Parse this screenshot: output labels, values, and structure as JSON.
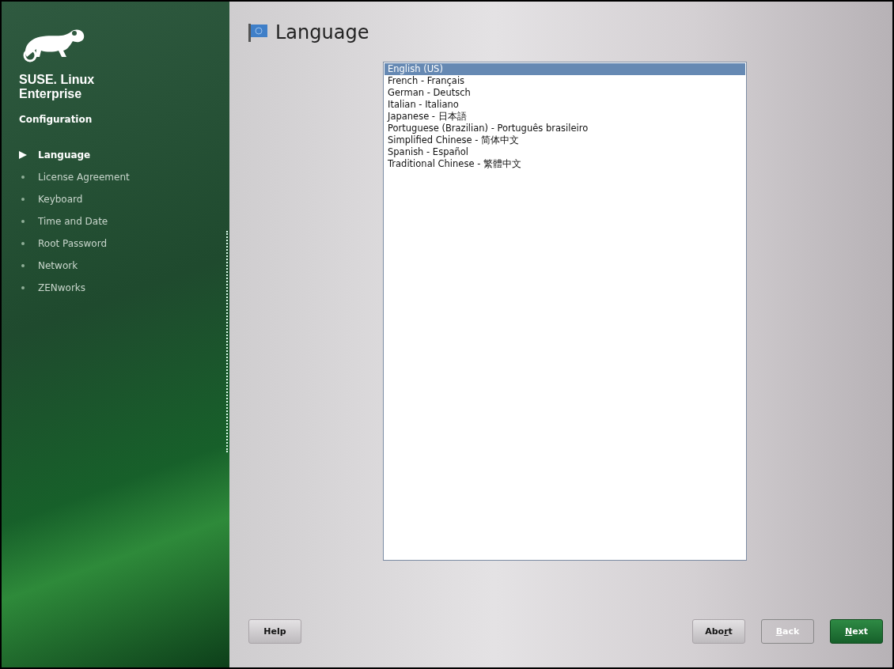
{
  "sidebar": {
    "brand": [
      "SUSE. Linux",
      "Enterprise"
    ],
    "section": "Configuration",
    "steps": [
      {
        "label": "Language",
        "current": true
      },
      {
        "label": "License Agreement",
        "current": false
      },
      {
        "label": "Keyboard",
        "current": false
      },
      {
        "label": "Time and Date",
        "current": false
      },
      {
        "label": "Root Password",
        "current": false
      },
      {
        "label": "Network",
        "current": false
      },
      {
        "label": "ZENworks",
        "current": false
      }
    ]
  },
  "page": {
    "title": "Language"
  },
  "languages": [
    {
      "label": "English (US)",
      "selected": true
    },
    {
      "label": "French - Français",
      "selected": false
    },
    {
      "label": "German - Deutsch",
      "selected": false
    },
    {
      "label": "Italian - Italiano",
      "selected": false
    },
    {
      "label": "Japanese - 日本語",
      "selected": false
    },
    {
      "label": "Portuguese (Brazilian) - Português brasileiro",
      "selected": false
    },
    {
      "label": "Simplified Chinese - 简体中文",
      "selected": false
    },
    {
      "label": "Spanish - Español",
      "selected": false
    },
    {
      "label": "Traditional Chinese - 繁體中文",
      "selected": false
    }
  ],
  "buttons": [
    {
      "label": [
        {
          "text": "Help",
          "underlined": false
        }
      ],
      "kind": "plain",
      "disabled": false
    },
    {
      "label": [
        {
          "text": "Abo",
          "underlined": false
        },
        {
          "text": "r",
          "underlined": true
        },
        {
          "text": "t",
          "underlined": false
        }
      ],
      "kind": "plain",
      "disabled": false
    },
    {
      "label": [
        {
          "text": "B",
          "underlined": true
        },
        {
          "text": "ack",
          "underlined": false
        }
      ],
      "kind": "plain",
      "disabled": true
    },
    {
      "label": [
        {
          "text": "N",
          "underlined": true
        },
        {
          "text": "ext",
          "underlined": false
        }
      ],
      "kind": "primary",
      "disabled": false
    }
  ]
}
